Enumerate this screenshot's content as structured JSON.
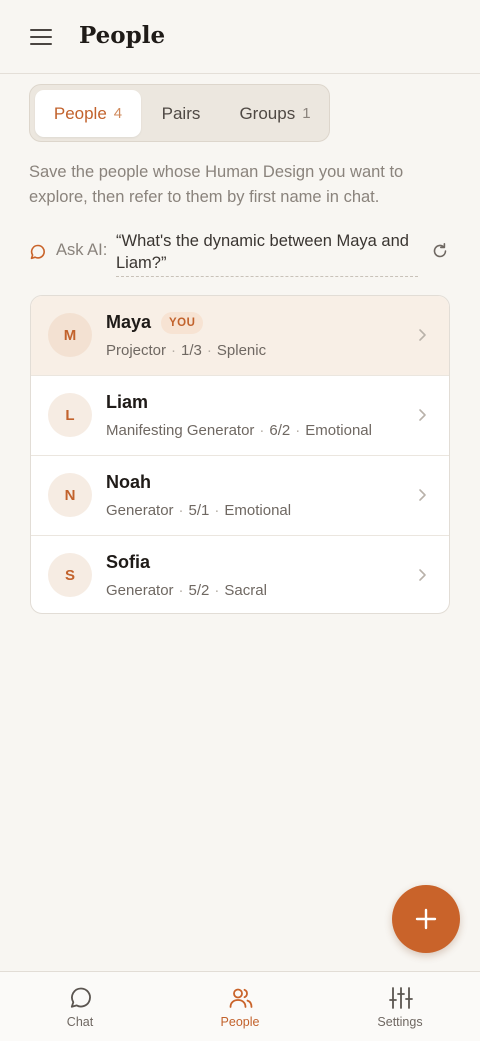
{
  "header": {
    "title": "People"
  },
  "tabs": [
    {
      "label": "People",
      "count": "4",
      "active": true
    },
    {
      "label": "Pairs",
      "count": "",
      "active": false
    },
    {
      "label": "Groups",
      "count": "1",
      "active": false
    }
  ],
  "intro": "Save the people whose Human Design you want to explore, then refer to them by first name in chat.",
  "ask": {
    "label": "Ask AI:",
    "suggestion": "“What's the dynamic between Maya and Liam?”"
  },
  "people": [
    {
      "initial": "M",
      "name": "Maya",
      "badge": "YOU",
      "type": "Projector",
      "profile": "1/3",
      "authority": "Splenic"
    },
    {
      "initial": "L",
      "name": "Liam",
      "type": "Manifesting Generator",
      "profile": "6/2",
      "authority": "Emotional"
    },
    {
      "initial": "N",
      "name": "Noah",
      "type": "Generator",
      "profile": "5/1",
      "authority": "Emotional"
    },
    {
      "initial": "S",
      "name": "Sofia",
      "type": "Generator",
      "profile": "5/2",
      "authority": "Sacral"
    }
  ],
  "fab": {
    "icon": "plus-icon"
  },
  "nav": [
    {
      "label": "Chat",
      "icon": "chat-bubble-icon",
      "active": false
    },
    {
      "label": "People",
      "icon": "people-icon",
      "active": true
    },
    {
      "label": "Settings",
      "icon": "sliders-icon",
      "active": false
    }
  ],
  "colors": {
    "accent": "#c9632a",
    "background": "#f8f6f2"
  }
}
